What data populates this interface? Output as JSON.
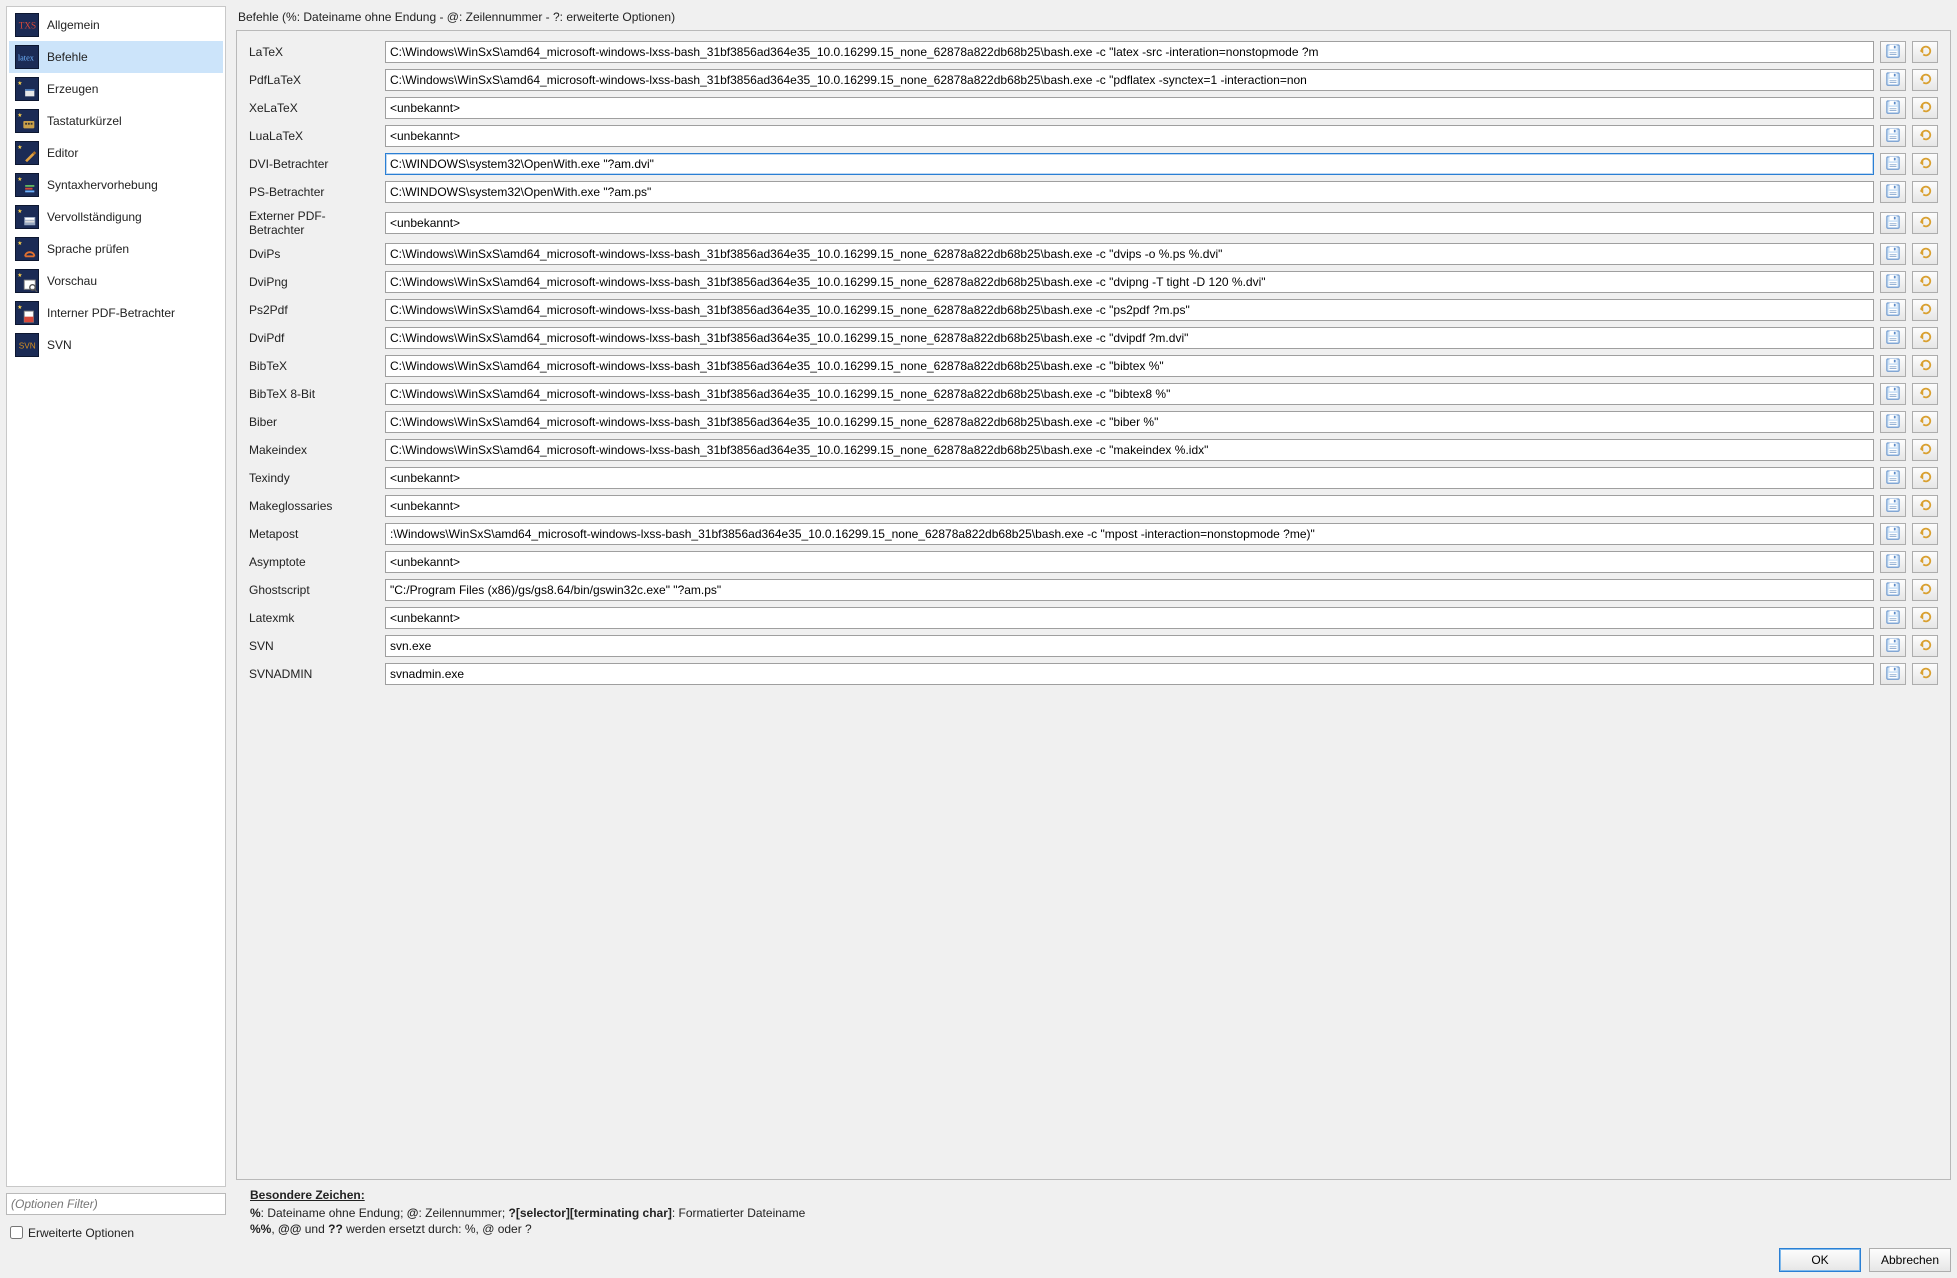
{
  "sidebar": {
    "filter_placeholder": "(Optionen Filter)",
    "advanced_label": "Erweiterte Optionen",
    "active_index": 1,
    "items": [
      {
        "label": "Allgemein",
        "icon": "txs"
      },
      {
        "label": "Befehle",
        "icon": "latex"
      },
      {
        "label": "Erzeugen",
        "icon": "build"
      },
      {
        "label": "Tastaturkürzel",
        "icon": "keys"
      },
      {
        "label": "Editor",
        "icon": "editor"
      },
      {
        "label": "Syntaxhervorhebung",
        "icon": "syntax"
      },
      {
        "label": "Vervollständigung",
        "icon": "complete"
      },
      {
        "label": "Sprache prüfen",
        "icon": "spell"
      },
      {
        "label": "Vorschau",
        "icon": "preview"
      },
      {
        "label": "Interner PDF-Betrachter",
        "icon": "pdf"
      },
      {
        "label": "SVN",
        "icon": "svn"
      }
    ]
  },
  "main": {
    "title": "Befehle (%: Dateiname ohne Endung - @: Zeilennummer - ?: erweiterte Optionen)",
    "focused_row": 4,
    "commands": [
      {
        "label": "LaTeX",
        "value": "C:\\Windows\\WinSxS\\amd64_microsoft-windows-lxss-bash_31bf3856ad364e35_10.0.16299.15_none_62878a822db68b25\\bash.exe -c \"latex -src -interation=nonstopmode ?m"
      },
      {
        "label": "PdfLaTeX",
        "value": "C:\\Windows\\WinSxS\\amd64_microsoft-windows-lxss-bash_31bf3856ad364e35_10.0.16299.15_none_62878a822db68b25\\bash.exe -c \"pdflatex -synctex=1 -interaction=non"
      },
      {
        "label": "XeLaTeX",
        "value": "<unbekannt>"
      },
      {
        "label": "LuaLaTeX",
        "value": "<unbekannt>"
      },
      {
        "label": "DVI-Betrachter",
        "value": "C:\\WINDOWS\\system32\\OpenWith.exe \"?am.dvi\""
      },
      {
        "label": "PS-Betrachter",
        "value": "C:\\WINDOWS\\system32\\OpenWith.exe \"?am.ps\""
      },
      {
        "label": "Externer PDF-Betrachter",
        "value": "<unbekannt>"
      },
      {
        "label": "DviPs",
        "value": "C:\\Windows\\WinSxS\\amd64_microsoft-windows-lxss-bash_31bf3856ad364e35_10.0.16299.15_none_62878a822db68b25\\bash.exe -c \"dvips -o %.ps %.dvi\""
      },
      {
        "label": "DviPng",
        "value": "C:\\Windows\\WinSxS\\amd64_microsoft-windows-lxss-bash_31bf3856ad364e35_10.0.16299.15_none_62878a822db68b25\\bash.exe -c \"dvipng -T tight -D 120 %.dvi\""
      },
      {
        "label": "Ps2Pdf",
        "value": "C:\\Windows\\WinSxS\\amd64_microsoft-windows-lxss-bash_31bf3856ad364e35_10.0.16299.15_none_62878a822db68b25\\bash.exe -c \"ps2pdf ?m.ps\""
      },
      {
        "label": "DviPdf",
        "value": "C:\\Windows\\WinSxS\\amd64_microsoft-windows-lxss-bash_31bf3856ad364e35_10.0.16299.15_none_62878a822db68b25\\bash.exe -c \"dvipdf ?m.dvi\""
      },
      {
        "label": "BibTeX",
        "value": "C:\\Windows\\WinSxS\\amd64_microsoft-windows-lxss-bash_31bf3856ad364e35_10.0.16299.15_none_62878a822db68b25\\bash.exe -c \"bibtex %\""
      },
      {
        "label": "BibTeX 8-Bit",
        "value": "C:\\Windows\\WinSxS\\amd64_microsoft-windows-lxss-bash_31bf3856ad364e35_10.0.16299.15_none_62878a822db68b25\\bash.exe -c \"bibtex8 %\""
      },
      {
        "label": "Biber",
        "value": "C:\\Windows\\WinSxS\\amd64_microsoft-windows-lxss-bash_31bf3856ad364e35_10.0.16299.15_none_62878a822db68b25\\bash.exe -c \"biber %\""
      },
      {
        "label": "Makeindex",
        "value": "C:\\Windows\\WinSxS\\amd64_microsoft-windows-lxss-bash_31bf3856ad364e35_10.0.16299.15_none_62878a822db68b25\\bash.exe -c \"makeindex %.idx\""
      },
      {
        "label": "Texindy",
        "value": "<unbekannt>"
      },
      {
        "label": "Makeglossaries",
        "value": "<unbekannt>"
      },
      {
        "label": "Metapost",
        "value": ":\\Windows\\WinSxS\\amd64_microsoft-windows-lxss-bash_31bf3856ad364e35_10.0.16299.15_none_62878a822db68b25\\bash.exe -c \"mpost -interaction=nonstopmode ?me)\""
      },
      {
        "label": "Asymptote",
        "value": "<unbekannt>"
      },
      {
        "label": "Ghostscript",
        "value": "\"C:/Program Files (x86)/gs/gs8.64/bin/gswin32c.exe\" \"?am.ps\""
      },
      {
        "label": "Latexmk",
        "value": "<unbekannt>"
      },
      {
        "label": "SVN",
        "value": "svn.exe"
      },
      {
        "label": "SVNADMIN",
        "value": "svnadmin.exe"
      }
    ]
  },
  "notes": {
    "header": "Besondere Zeichen:",
    "line1_a": "%",
    "line1_b": ": Dateiname ohne Endung; ",
    "line1_c": "@",
    "line1_d": ": Zeilennummer; ",
    "line1_e": "?[selector][terminating char]",
    "line1_f": ": Formatierter Dateiname",
    "line2_a": "%%",
    "line2_b": ", ",
    "line2_c": "@@",
    "line2_d": " und ",
    "line2_e": "??",
    "line2_f": " werden ersetzt durch: %, @ oder ?"
  },
  "buttons": {
    "ok": "OK",
    "cancel": "Abbrechen"
  }
}
